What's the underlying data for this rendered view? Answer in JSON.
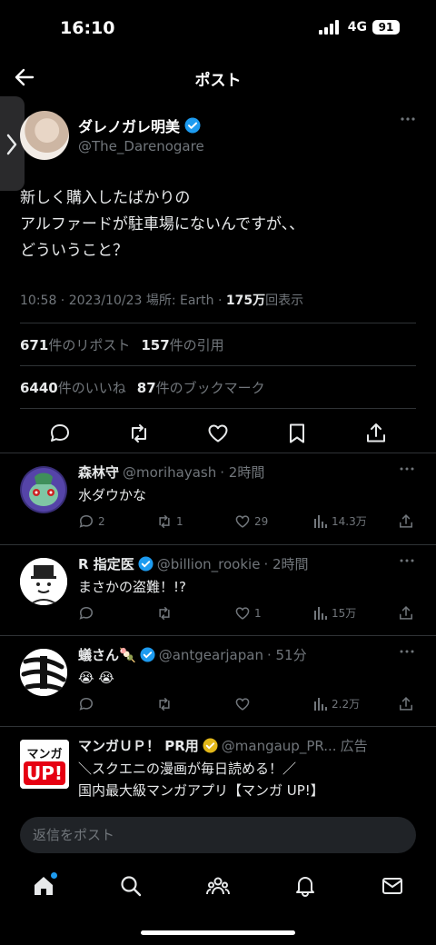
{
  "status": {
    "time": "16:10",
    "network": "4G",
    "battery": "91"
  },
  "nav": {
    "title": "ポスト"
  },
  "post": {
    "author_name": "ダレノガレ明美",
    "author_handle": "@The_Darenogare",
    "text": "新しく購入したばかりの\nアルファードが駐車場にないんですが、、\nどういうこと？",
    "meta_prefix": "10:58 · 2023/10/23 場所: Earth · ",
    "views": "175万",
    "views_suffix": "回表示",
    "reposts": "671",
    "reposts_label": "件のリポスト",
    "quotes": "157",
    "quotes_label": "件の引用",
    "likes": "6440",
    "likes_label": "件のいいね",
    "bookmarks": "87",
    "bookmarks_label": "件のブックマーク"
  },
  "replies": [
    {
      "name": "森林守",
      "handle": "@morihayash",
      "time": "· 2時間",
      "text": "水ダウかな",
      "replies": "2",
      "reposts": "1",
      "likes": "29",
      "views": "14.3万"
    },
    {
      "name": "R 指定医",
      "handle": "@billion_rookie",
      "time": "· 2時間",
      "text": "まさかの盗難！!?",
      "replies": "",
      "reposts": "",
      "likes": "1",
      "views": "15万"
    },
    {
      "name": "蟻さん🍡",
      "handle": "@antgearjapan",
      "time": "· 51分",
      "text": "😭 😭",
      "replies": "",
      "reposts": "",
      "likes": "",
      "views": "2.2万"
    }
  ],
  "ad": {
    "name": "マンガＵＰ！ PR用",
    "handle": "@mangaup_PR...",
    "badge": "広告",
    "text": "＼スクエニの漫画が毎日読める！／\n国内最大級マンガアプリ【マンガ UP!】",
    "logo_text_top": "マンガ",
    "logo_text_bottom": "UP!"
  },
  "compose": {
    "placeholder": "返信をポスト"
  },
  "colors": {
    "accent": "#1d9bf0",
    "gold": "#e2b719",
    "muted": "#71767b",
    "ad_red": "#e60012"
  },
  "icons": {
    "nav": "back-arrow-icon",
    "actions": [
      "reply-icon",
      "repost-icon",
      "like-icon",
      "bookmark-icon",
      "share-icon"
    ],
    "tabs": [
      "home-icon",
      "search-icon",
      "communities-icon",
      "notifications-icon",
      "messages-icon"
    ]
  }
}
